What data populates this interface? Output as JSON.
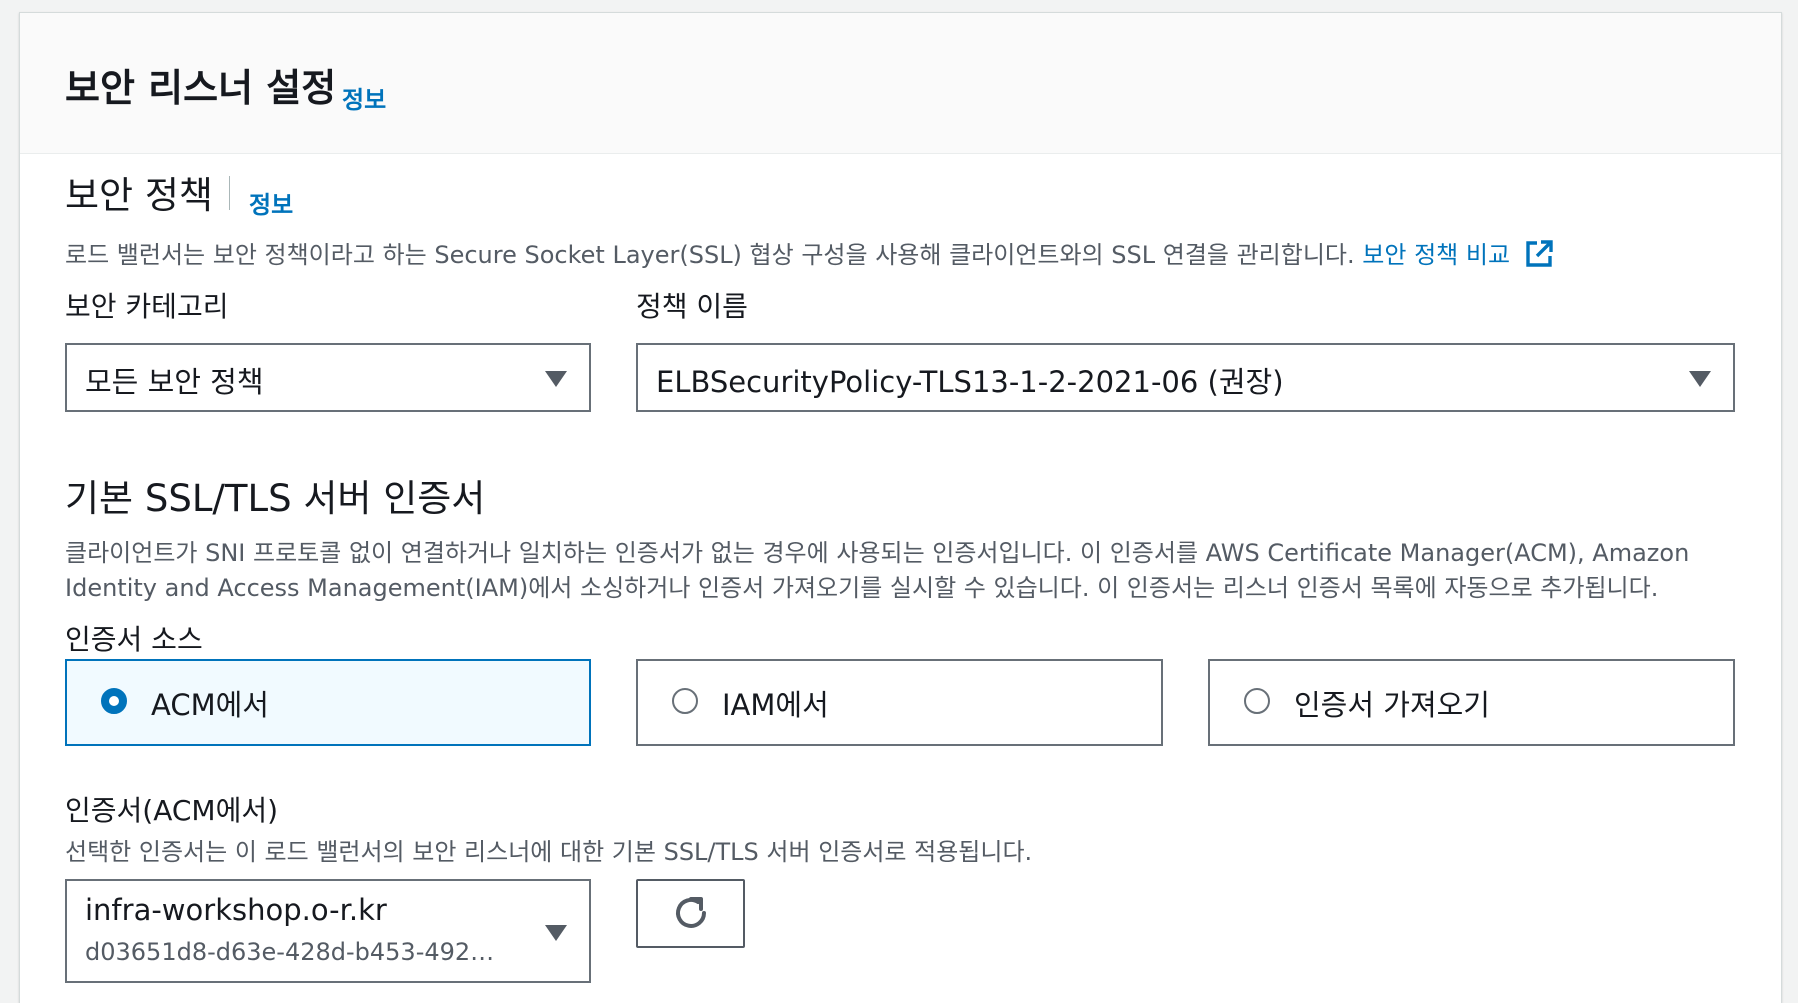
{
  "header": {
    "title": "보안 리스너 설정",
    "info": "정보"
  },
  "security_policy": {
    "title": "보안 정책",
    "info": "정보",
    "description": "로드 밸런서는 보안 정책이라고 하는 Secure Socket Layer(SSL) 협상 구성을 사용해 클라이언트와의 SSL 연결을 관리합니다.",
    "compare_link": "보안 정책 비교",
    "category_label": "보안 카테고리",
    "category_value": "모든 보안 정책",
    "policy_label": "정책 이름",
    "policy_value": "ELBSecurityPolicy-TLS13-1-2-2021-06 (권장)"
  },
  "default_cert": {
    "title": "기본 SSL/TLS 서버 인증서",
    "description_line1": "클라이언트가 SNI 프로토콜 없이 연결하거나 일치하는 인증서가 없는 경우에 사용되는 인증서입니다. 이 인증서를 AWS Certificate Manager(ACM), Amazon",
    "description_line2": "Identity and Access Management(IAM)에서 소싱하거나 인증서 가져오기를 실시할 수 있습니다. 이 인증서는 리스너 인증서 목록에 자동으로 추가됩니다.",
    "source_label": "인증서 소스",
    "sources": [
      {
        "label": "ACM에서",
        "selected": true
      },
      {
        "label": "IAM에서",
        "selected": false
      },
      {
        "label": "인증서 가져오기",
        "selected": false
      }
    ],
    "acm_label": "인증서(ACM에서)",
    "acm_description": "선택한 인증서는 이 로드 밸런서의 보안 리스너에 대한 기본 SSL/TLS 서버 인증서로 적용됩니다.",
    "acm_value": "infra-workshop.o-r.kr",
    "acm_value_sub": "d03651d8-d63e-428d-b453-492…"
  },
  "colors": {
    "accent": "#0073bb",
    "border": "#687078",
    "text": "#16191f",
    "muted": "#545b64"
  },
  "icons": {
    "caret": "caret-down-icon",
    "external": "external-link-icon",
    "refresh": "refresh-icon"
  }
}
